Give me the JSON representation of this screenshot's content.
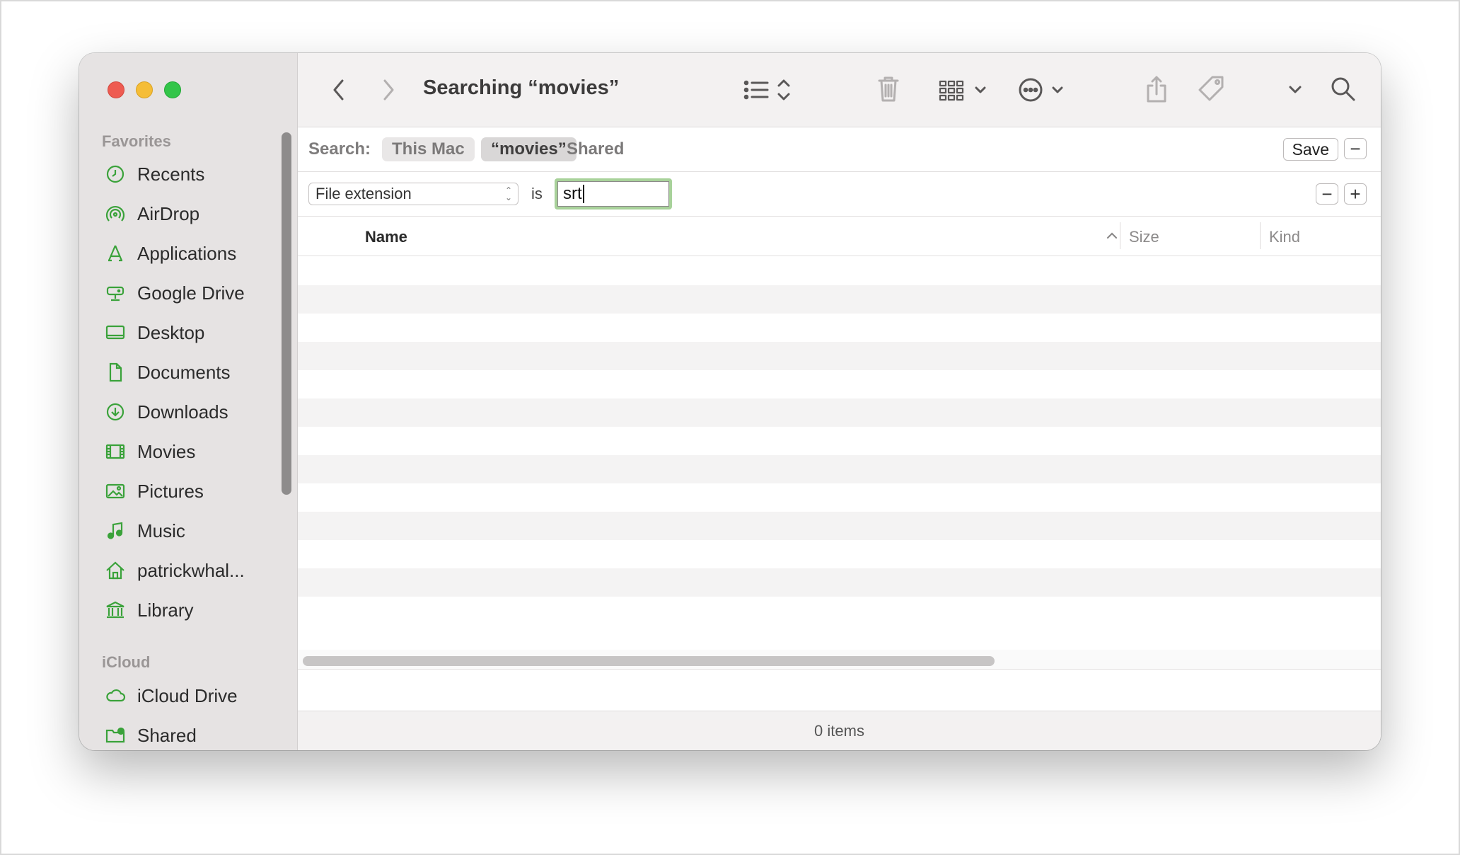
{
  "window": {
    "title": "Searching “movies”"
  },
  "sidebar": {
    "favorites_label": "Favorites",
    "favorites": [
      {
        "label": "Recents",
        "icon": "clock-icon"
      },
      {
        "label": "AirDrop",
        "icon": "airdrop-icon"
      },
      {
        "label": "Applications",
        "icon": "applications-icon"
      },
      {
        "label": "Google Drive",
        "icon": "drive-icon"
      },
      {
        "label": "Desktop",
        "icon": "desktop-icon"
      },
      {
        "label": "Documents",
        "icon": "document-icon"
      },
      {
        "label": "Downloads",
        "icon": "download-icon"
      },
      {
        "label": "Movies",
        "icon": "film-icon"
      },
      {
        "label": "Pictures",
        "icon": "picture-icon"
      },
      {
        "label": "Music",
        "icon": "music-note-icon"
      },
      {
        "label": "patrickwhal...",
        "icon": "home-icon"
      },
      {
        "label": "Library",
        "icon": "library-icon"
      }
    ],
    "icloud_label": "iCloud",
    "icloud": [
      {
        "label": "iCloud Drive",
        "icon": "cloud-icon"
      },
      {
        "label": "Shared",
        "icon": "shared-folder-icon"
      }
    ],
    "accent_color": "#3aa23a"
  },
  "search": {
    "label": "Search:",
    "scopes": [
      "This Mac",
      "“movies”",
      "Shared"
    ],
    "selected_scope": "“movies”",
    "save_label": "Save",
    "minus": "−",
    "plus": "+"
  },
  "criteria": {
    "attribute": "File extension",
    "operator": "is",
    "value": "srt"
  },
  "columns": {
    "name": "Name",
    "size": "Size",
    "kind": "Kind"
  },
  "status": {
    "items": "0 items"
  }
}
